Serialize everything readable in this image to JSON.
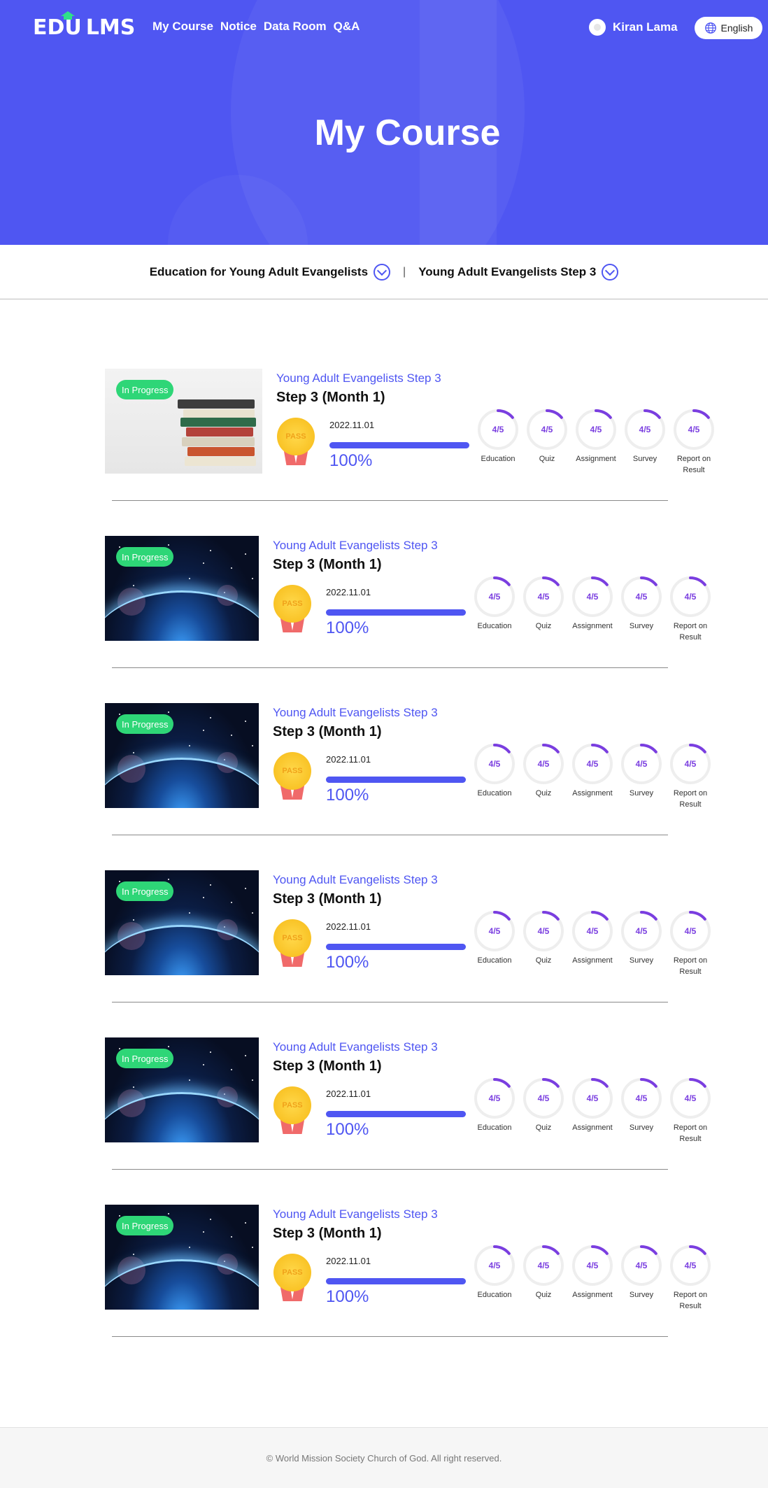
{
  "header": {
    "logo_left": "EDU",
    "logo_right": "LMS",
    "nav": [
      "My Course",
      "Notice",
      "Data Room",
      "Q&A"
    ],
    "user_name": "Kiran Lama",
    "language": "English",
    "brand_color": "#4f56f2"
  },
  "hero": {
    "title": "My Course"
  },
  "filter": {
    "first": "Education for Young Adult Evangelists",
    "separator": "|",
    "second": "Young Adult Evangelists Step 3"
  },
  "courses": [
    {
      "image": "books",
      "status": "In Progress",
      "title": "Young Adult Evangelists Step 3",
      "subtitle": "Step 3 (Month 1)",
      "medal_text": "PASS",
      "date": "2022.11.01",
      "progress_value": 100,
      "progress_text": "100%",
      "rings": [
        {
          "value": "4/5",
          "label": "Education"
        },
        {
          "value": "4/5",
          "label": "Quiz"
        },
        {
          "value": "4/5",
          "label": "Assignment"
        },
        {
          "value": "4/5",
          "label": "Survey"
        },
        {
          "value": "4/5",
          "label": "Report on Result"
        }
      ]
    },
    {
      "image": "space",
      "status": "In Progress",
      "title": "Young Adult Evangelists Step 3",
      "subtitle": "Step 3 (Month 1)",
      "medal_text": "PASS",
      "date": "2022.11.01",
      "progress_value": 100,
      "progress_text": "100%",
      "rings": [
        {
          "value": "4/5",
          "label": "Education"
        },
        {
          "value": "4/5",
          "label": "Quiz"
        },
        {
          "value": "4/5",
          "label": "Assignment"
        },
        {
          "value": "4/5",
          "label": "Survey"
        },
        {
          "value": "4/5",
          "label": "Report on Result"
        }
      ]
    },
    {
      "image": "space",
      "status": "In Progress",
      "title": "Young Adult Evangelists Step 3",
      "subtitle": "Step 3 (Month 1)",
      "medal_text": "PASS",
      "date": "2022.11.01",
      "progress_value": 100,
      "progress_text": "100%",
      "rings": [
        {
          "value": "4/5",
          "label": "Education"
        },
        {
          "value": "4/5",
          "label": "Quiz"
        },
        {
          "value": "4/5",
          "label": "Assignment"
        },
        {
          "value": "4/5",
          "label": "Survey"
        },
        {
          "value": "4/5",
          "label": "Report on Result"
        }
      ]
    },
    {
      "image": "space",
      "status": "In Progress",
      "title": "Young Adult Evangelists Step 3",
      "subtitle": "Step 3 (Month 1)",
      "medal_text": "PASS",
      "date": "2022.11.01",
      "progress_value": 100,
      "progress_text": "100%",
      "rings": [
        {
          "value": "4/5",
          "label": "Education"
        },
        {
          "value": "4/5",
          "label": "Quiz"
        },
        {
          "value": "4/5",
          "label": "Assignment"
        },
        {
          "value": "4/5",
          "label": "Survey"
        },
        {
          "value": "4/5",
          "label": "Report on Result"
        }
      ]
    },
    {
      "image": "space",
      "status": "In Progress",
      "title": "Young Adult Evangelists Step 3",
      "subtitle": "Step 3 (Month 1)",
      "medal_text": "PASS",
      "date": "2022.11.01",
      "progress_value": 100,
      "progress_text": "100%",
      "rings": [
        {
          "value": "4/5",
          "label": "Education"
        },
        {
          "value": "4/5",
          "label": "Quiz"
        },
        {
          "value": "4/5",
          "label": "Assignment"
        },
        {
          "value": "4/5",
          "label": "Survey"
        },
        {
          "value": "4/5",
          "label": "Report on Result"
        }
      ]
    },
    {
      "image": "space",
      "status": "In Progress",
      "title": "Young Adult Evangelists Step 3",
      "subtitle": "Step 3 (Month 1)",
      "medal_text": "PASS",
      "date": "2022.11.01",
      "progress_value": 100,
      "progress_text": "100%",
      "rings": [
        {
          "value": "4/5",
          "label": "Education"
        },
        {
          "value": "4/5",
          "label": "Quiz"
        },
        {
          "value": "4/5",
          "label": "Assignment"
        },
        {
          "value": "4/5",
          "label": "Survey"
        },
        {
          "value": "4/5",
          "label": "Report on Result"
        }
      ]
    }
  ],
  "footer": {
    "copyright": "© World Mission Society Church of God. All right reserved."
  }
}
